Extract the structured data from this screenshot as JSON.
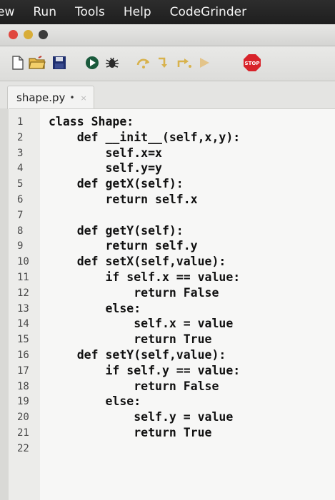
{
  "menubar": {
    "items": [
      "ew",
      "Run",
      "Tools",
      "Help",
      "CodeGrinder"
    ]
  },
  "window": {
    "controls": [
      "close-icon",
      "minimize-icon",
      "zoom-icon"
    ],
    "colors": {
      "close": "#e0473e",
      "minimize": "#d8ad38",
      "zoom": "#3b3b3b"
    }
  },
  "toolbar": {
    "icons": [
      "new-file-icon",
      "open-folder-icon",
      "save-icon",
      "run-icon",
      "debug-icon",
      "step-over-icon",
      "step-into-icon",
      "step-out-icon",
      "resume-icon",
      "stop-icon"
    ],
    "stop_label": "STOP"
  },
  "editor": {
    "tab": {
      "filename": "shape.py",
      "modified": "•",
      "close": "×"
    },
    "lines": [
      "class Shape:",
      "    def __init__(self,x,y):",
      "        self.x=x",
      "        self.y=y",
      "    def getX(self):",
      "        return self.x",
      "",
      "    def getY(self):",
      "        return self.y",
      "    def setX(self,value):",
      "        if self.x == value:",
      "            return False",
      "        else:",
      "            self.x = value",
      "            return True",
      "    def setY(self,value):",
      "        if self.y == value:",
      "            return False",
      "        else:",
      "            self.y = value",
      "            return True",
      ""
    ],
    "line_numbers": [
      "1",
      "2",
      "3",
      "4",
      "5",
      "6",
      "7",
      "8",
      "9",
      "10",
      "11",
      "12",
      "13",
      "14",
      "15",
      "16",
      "17",
      "18",
      "19",
      "20",
      "21",
      "22"
    ]
  }
}
